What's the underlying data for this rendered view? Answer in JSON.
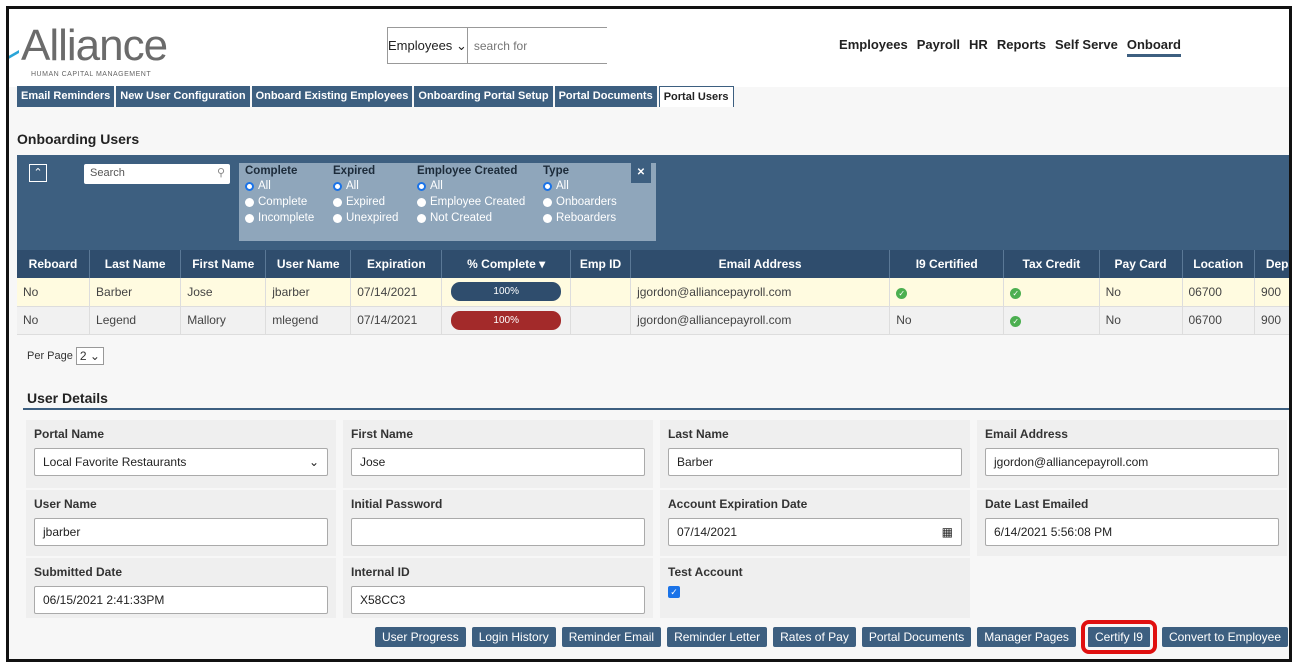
{
  "brand": {
    "name": "Alliance",
    "tagline": "HUMAN CAPITAL MANAGEMENT"
  },
  "header_search": {
    "scope": "Employees",
    "placeholder": "search for"
  },
  "top_nav": [
    {
      "label": "Employees"
    },
    {
      "label": "Payroll"
    },
    {
      "label": "HR"
    },
    {
      "label": "Reports"
    },
    {
      "label": "Self Serve"
    },
    {
      "label": "Onboard",
      "active": true
    }
  ],
  "tabs": [
    {
      "label": "Email Reminders"
    },
    {
      "label": "New User Configuration"
    },
    {
      "label": "Onboard Existing Employees"
    },
    {
      "label": "Onboarding Portal Setup"
    },
    {
      "label": "Portal Documents"
    },
    {
      "label": "Portal Users",
      "active": true
    }
  ],
  "section_title": "Onboarding Users",
  "filters": {
    "search_placeholder": "Search",
    "groups": [
      {
        "title": "Complete",
        "options": [
          "All",
          "Complete",
          "Incomplete"
        ],
        "selected": "All"
      },
      {
        "title": "Expired",
        "options": [
          "All",
          "Expired",
          "Unexpired"
        ],
        "selected": "All"
      },
      {
        "title": "Employee Created",
        "options": [
          "All",
          "Employee Created",
          "Not Created"
        ],
        "selected": "All"
      },
      {
        "title": "Type",
        "options": [
          "All",
          "Onboarders",
          "Reboarders"
        ],
        "selected": "All"
      }
    ]
  },
  "table": {
    "columns": [
      "Reboard",
      "Last Name",
      "First Name",
      "User Name",
      "Expiration",
      "% Complete ▾",
      "Emp ID",
      "Email Address",
      "I9 Certified",
      "Tax Credit",
      "Pay Card",
      "Location",
      "Depa"
    ],
    "rows": [
      {
        "reboard": "No",
        "last": "Barber",
        "first": "Jose",
        "user": "jbarber",
        "exp": "07/14/2021",
        "pct": "100%",
        "pct_value": 100,
        "bar_color": "#2f4d6d",
        "emp_id": "",
        "email": "jgordon@alliancepayroll.com",
        "i9": "check",
        "tax": "check",
        "paycard": "No",
        "location": "06700",
        "dept": "900"
      },
      {
        "reboard": "No",
        "last": "Legend",
        "first": "Mallory",
        "user": "mlegend",
        "exp": "07/14/2021",
        "pct": "100%",
        "pct_value": 100,
        "bar_color": "#a32a2a",
        "emp_id": "",
        "email": "jgordon@alliancepayroll.com",
        "i9": "No",
        "tax": "check",
        "paycard": "No",
        "location": "06700",
        "dept": "900"
      }
    ]
  },
  "per_page": {
    "label": "Per Page",
    "value": "2"
  },
  "user_details": {
    "title": "User Details",
    "fields": [
      {
        "label": "Portal Name",
        "value": "Local Favorite Restaurants",
        "type": "select"
      },
      {
        "label": "First Name",
        "value": "Jose"
      },
      {
        "label": "Last Name",
        "value": "Barber"
      },
      {
        "label": "Email Address",
        "value": "jgordon@alliancepayroll.com"
      },
      {
        "label": "User Name",
        "value": "jbarber"
      },
      {
        "label": "Initial Password",
        "value": ""
      },
      {
        "label": "Account Expiration Date",
        "value": "07/14/2021",
        "type": "date"
      },
      {
        "label": "Date Last Emailed",
        "value": "6/14/2021 5:56:08 PM"
      },
      {
        "label": "Submitted Date",
        "value": "06/15/2021 2:41:33PM"
      },
      {
        "label": "Internal ID",
        "value": "X58CC3"
      },
      {
        "label": "Test Account",
        "value": "checked",
        "type": "checkbox"
      }
    ]
  },
  "actions": [
    {
      "label": "User Progress"
    },
    {
      "label": "Login History"
    },
    {
      "label": "Reminder Email"
    },
    {
      "label": "Reminder Letter"
    },
    {
      "label": "Rates of Pay"
    },
    {
      "label": "Portal Documents"
    },
    {
      "label": "Manager Pages"
    },
    {
      "label": "Certify I9",
      "highlighted": true,
      "highlight_color": "#e01010"
    },
    {
      "label": "Convert to Employee"
    }
  ]
}
